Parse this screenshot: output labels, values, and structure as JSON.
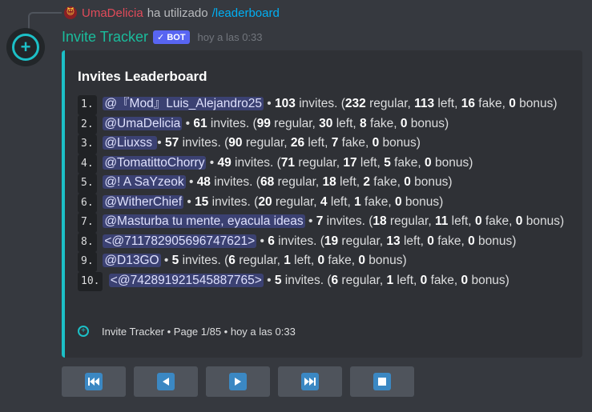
{
  "reply": {
    "avatar_glyph": "😈",
    "username": "UmaDelicia",
    "middle": "ha utilizado",
    "command": "/leaderboard"
  },
  "message": {
    "bot_name": "Invite Tracker",
    "bot_tag": "✓ BOT",
    "timestamp": "hoy a las 0:33"
  },
  "embed": {
    "accent_color": "#1cc0c7",
    "title": "Invites Leaderboard",
    "entries": [
      {
        "rank": "1.",
        "user": "@『Mod』Luis_Alejandro25",
        "total": "103",
        "regular": "232",
        "left": "113",
        "fake": "16",
        "bonus": "0"
      },
      {
        "rank": "2.",
        "user": "@UmaDelicia",
        "total": "61",
        "regular": "99",
        "left": "30",
        "fake": "8",
        "bonus": "0"
      },
      {
        "rank": "3.",
        "user": "@Liuxss ",
        "total": "57",
        "regular": "90",
        "left": "26",
        "fake": "7",
        "bonus": "0"
      },
      {
        "rank": "4.",
        "user": "@TomatittoChorry",
        "total": "49",
        "regular": "71",
        "left": "17",
        "fake": "5",
        "bonus": "0"
      },
      {
        "rank": "5.",
        "user": "@! A SaYzeok",
        "total": "48",
        "regular": "68",
        "left": "18",
        "fake": "2",
        "bonus": "0"
      },
      {
        "rank": "6.",
        "user": "@WitherChief",
        "total": "15",
        "regular": "20",
        "left": "4",
        "fake": "1",
        "bonus": "0"
      },
      {
        "rank": "7.",
        "user": "@Masturba tu mente, eyacula ideas",
        "total": "7",
        "regular": "18",
        "left": "11",
        "fake": "0",
        "bonus": "0"
      },
      {
        "rank": "8.",
        "user": "<@711782905696747621>",
        "total": "6",
        "regular": "19",
        "left": "13",
        "fake": "0",
        "bonus": "0"
      },
      {
        "rank": "9.",
        "user": "@D13GO",
        "total": "5",
        "regular": "6",
        "left": "1",
        "fake": "0",
        "bonus": "0"
      },
      {
        "rank": "10.",
        "user": "<@742891921545887765>",
        "total": "5",
        "regular": "6",
        "left": "1",
        "fake": "0",
        "bonus": "0"
      }
    ],
    "footer": "Invite Tracker • Page 1/85 • hoy a las 0:33"
  },
  "buttons": [
    {
      "name": "first-page-button",
      "icon": "fast-backward-icon"
    },
    {
      "name": "previous-page-button",
      "icon": "reverse-play-icon"
    },
    {
      "name": "next-page-button",
      "icon": "play-icon"
    },
    {
      "name": "last-page-button",
      "icon": "fast-forward-icon"
    },
    {
      "name": "stop-button",
      "icon": "stop-icon"
    }
  ]
}
